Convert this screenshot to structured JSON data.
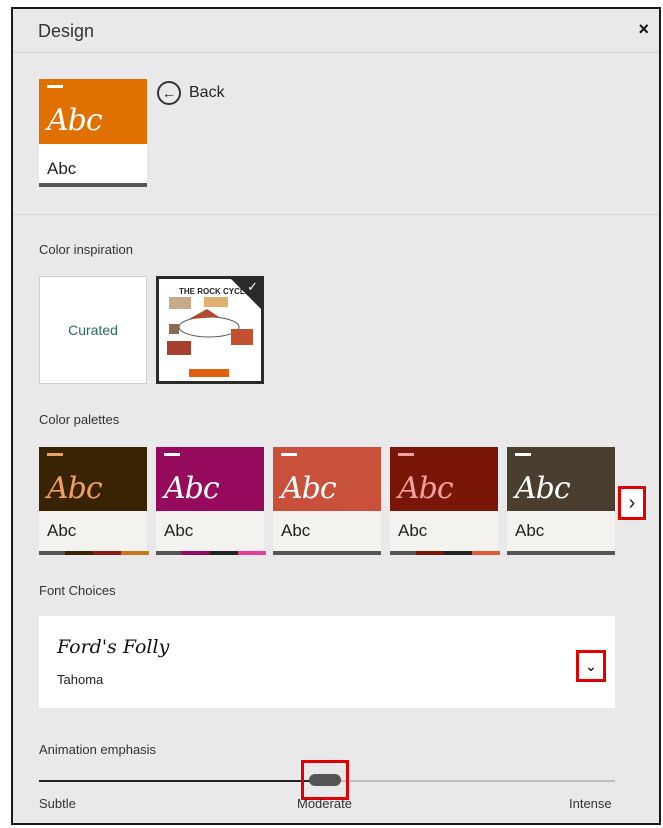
{
  "window": {
    "title": "Design",
    "close_glyph": "×"
  },
  "preview": {
    "script_text": "Abc",
    "label": "Abc",
    "color": "#e07000"
  },
  "back": {
    "label": "Back",
    "icon": "back-arrow-icon"
  },
  "color_inspiration": {
    "label": "Color inspiration",
    "curated_label": "Curated",
    "image_title": "THE ROCK CYCLE",
    "selected_icon": "checkmark-icon"
  },
  "palettes": {
    "label": "Color palettes",
    "items": [
      {
        "script": "Abc",
        "label": "Abc",
        "top": "#3a2204",
        "script_color": "#f0a060",
        "accents": [
          "#3a2204",
          "#8b1a1a",
          "#c7781c"
        ]
      },
      {
        "script": "Abc",
        "label": "Abc",
        "top": "#950a5c",
        "script_color": "#ffffff",
        "accents": [
          "#950a5c",
          "#222222",
          "#e83e9a"
        ]
      },
      {
        "script": "Abc",
        "label": "Abc",
        "top": "#c9503a",
        "script_color": "#ffffff",
        "accents": [
          "#c9503a",
          "#555555",
          "#c9503a"
        ]
      },
      {
        "script": "Abc",
        "label": "Abc",
        "top": "#7a1608",
        "script_color": "#f0a0a0",
        "accents": [
          "#7a1608",
          "#222222",
          "#e05a3a"
        ]
      },
      {
        "script": "Abc",
        "label": "Abc",
        "top": "#4a3f2e",
        "script_color": "#ffffff",
        "accents": [
          "#4a3f2e",
          "#555555",
          "#777777"
        ]
      }
    ],
    "next_icon": "chevron-right-icon"
  },
  "fonts": {
    "label": "Font Choices",
    "heading_font": "Ford's Folly",
    "body_font": "Tahoma",
    "dropdown_icon": "chevron-down-icon"
  },
  "animation": {
    "label": "Animation emphasis",
    "min_label": "Subtle",
    "mid_label": "Moderate",
    "max_label": "Intense",
    "level": 0.5
  }
}
